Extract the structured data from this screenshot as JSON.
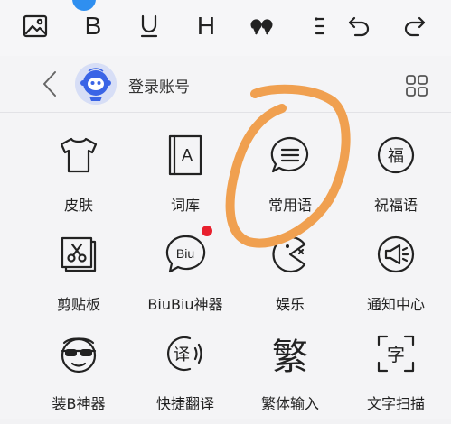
{
  "toolbar": {
    "items": [
      {
        "name": "image-icon"
      },
      {
        "name": "bold-button",
        "label": "B"
      },
      {
        "name": "underline-button"
      },
      {
        "name": "heading-button",
        "label": "H"
      },
      {
        "name": "quote-button"
      },
      {
        "name": "list-button"
      },
      {
        "name": "undo-button"
      },
      {
        "name": "redo-button"
      }
    ]
  },
  "header": {
    "login_label": "登录账号"
  },
  "grid": {
    "items": [
      {
        "label": "皮肤",
        "icon": "tshirt-icon"
      },
      {
        "label": "词库",
        "icon": "dictionary-icon"
      },
      {
        "label": "常用语",
        "icon": "chat-bubble-icon"
      },
      {
        "label": "祝福语",
        "icon": "blessing-icon"
      },
      {
        "label": "剪贴板",
        "icon": "clipboard-scissors-icon"
      },
      {
        "label": "BiuBiu神器",
        "icon": "biu-bubble-icon",
        "badge": true
      },
      {
        "label": "娱乐",
        "icon": "pacman-icon"
      },
      {
        "label": "通知中心",
        "icon": "megaphone-icon"
      },
      {
        "label": "装B神器",
        "icon": "sunglasses-face-icon"
      },
      {
        "label": "快捷翻译",
        "icon": "translate-icon"
      },
      {
        "label": "繁体输入",
        "icon": "traditional-char-icon"
      },
      {
        "label": "文字扫描",
        "icon": "text-scan-icon"
      }
    ],
    "icon_text": {
      "dictionary": "A",
      "blessing": "福",
      "biu": "Biu",
      "translate": "译",
      "traditional": "繁",
      "scan": "字"
    }
  },
  "colors": {
    "annotation": "#f0a050",
    "badge": "#e8202e",
    "avatar_accent": "#2f6ff0"
  }
}
